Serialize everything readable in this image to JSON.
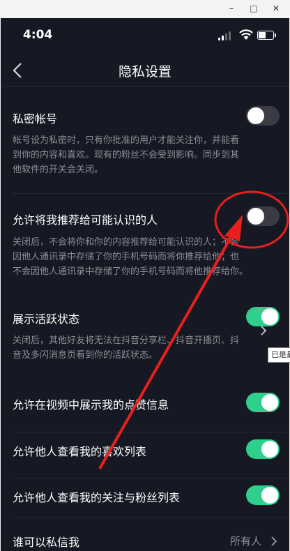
{
  "status": {
    "time": "4:04"
  },
  "nav": {
    "title": "隐私设置"
  },
  "rows": [
    {
      "label": "私密帐号",
      "toggle": "off",
      "desc": [
        "帐号设为私密时，只有你批准的用户才能关注你，并能看",
        "到你的内容和喜欢。现有的粉丝不会受到影响。同步到其",
        "他软件的开关会关闭。"
      ]
    },
    {
      "label": "允许将我推荐给可能认识的人",
      "toggle": "off",
      "desc": [
        "关闭后，不会将你和你的内容推荐给可能认识的人；不会",
        "因他人通讯录中存储了你的手机号码而将你推荐给他；也",
        "不会因他人通讯录中存储了你的手机号码而将他推荐给你。"
      ]
    },
    {
      "label": "展示活跃状态",
      "toggle": "on",
      "desc": [
        "关闭后，其他好友将无法在抖音分享栏、抖音开播页、抖",
        "音及多闪消息页看到你的活跃状态。"
      ]
    },
    {
      "label": "允许在视频中展示我的点赞信息",
      "toggle": "on"
    },
    {
      "label": "允许他人查看我的喜欢列表",
      "toggle": "on"
    },
    {
      "label": "允许他人查看我的关注与粉丝列表",
      "toggle": "on"
    },
    {
      "label": "谁可以私信我",
      "value": "所有人"
    }
  ],
  "tooltip": {
    "text": "已是最"
  },
  "colors": {
    "background": "#161823",
    "toggle_on": "#2fd08c",
    "toggle_off": "#3a3b45",
    "annotation": "#e8201c"
  }
}
